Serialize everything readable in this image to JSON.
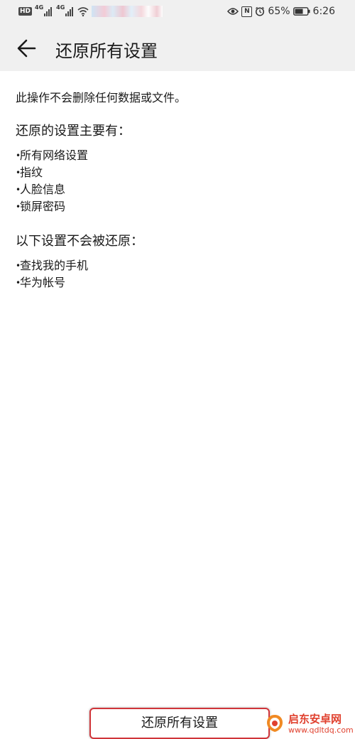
{
  "status_bar": {
    "hd": "HD",
    "network_1": "4G",
    "network_2": "4G",
    "battery_percent": "65%",
    "time": "6:26",
    "nfc": "N"
  },
  "app_bar": {
    "title": "还原所有设置"
  },
  "content": {
    "intro": "此操作不会删除任何数据或文件。",
    "section1_title": "还原的设置主要有：",
    "section1_items": [
      "所有网络设置",
      "指纹",
      "人脸信息",
      "锁屏密码"
    ],
    "section2_title": "以下设置不会被还原：",
    "section2_items": [
      "查找我的手机",
      "华为帐号"
    ]
  },
  "bottom": {
    "reset_button_label": "还原所有设置"
  },
  "watermark": {
    "name": "启东安卓网",
    "url": "www.qdltdq.com"
  },
  "colors": {
    "highlight_border": "#d0353a",
    "watermark": "#e0412f",
    "header_bg": "#f0f0f0"
  }
}
